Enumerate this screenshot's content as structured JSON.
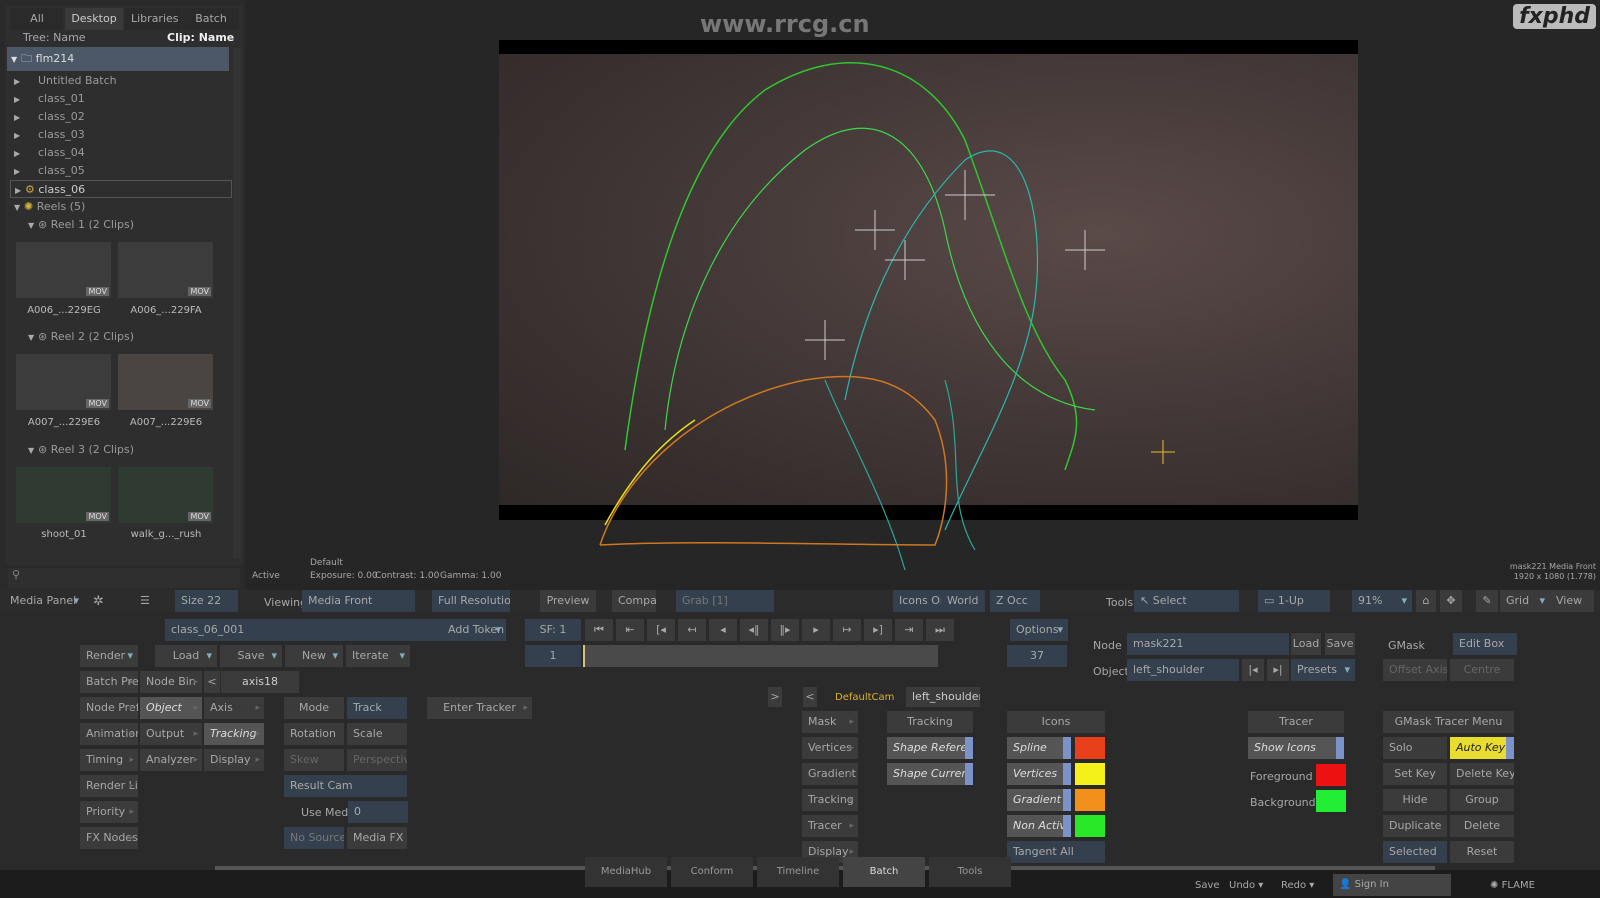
{
  "watermark": "www.rrcg.cn",
  "brand": "fxphd",
  "library": {
    "tabs": [
      "All",
      "Desktop",
      "Libraries",
      "Batch"
    ],
    "tree_label": "Tree: Name",
    "clip_label": "Clip: Name",
    "root": "flm214",
    "items": [
      "Untitled Batch",
      "class_01",
      "class_02",
      "class_03",
      "class_04",
      "class_05",
      "class_06"
    ],
    "reels": "Reels (5)",
    "reel_groups": [
      {
        "name": "Reel 1 (2 Clips)",
        "clips": [
          "A006_...229EG",
          "A006_...229FA"
        ]
      },
      {
        "name": "Reel 2 (2 Clips)",
        "clips": [
          "A007_...229E6",
          "A007_...229E6"
        ]
      },
      {
        "name": "Reel 3 (2 Clips)",
        "clips": [
          "shoot_01",
          "walk_g..._rush"
        ]
      }
    ],
    "badge": "MOV"
  },
  "viewer": {
    "status": "Active",
    "preset": "Default",
    "exposure": "Exposure: 0.00",
    "contrast": "Contrast: 1.00",
    "gamma": "Gamma: 1.00",
    "info1": "mask221 Media Front",
    "info2": "1920 x 1080 (1.778)"
  },
  "toolbar": {
    "media_panel": "Media Panel",
    "size": "Size 22",
    "viewing": "Viewing",
    "media_front": "Media Front",
    "full_res": "Full Resolution",
    "preview": "Preview",
    "compare": "Compare",
    "grab": "Grab [1]",
    "icons_on": "Icons On",
    "world": "World",
    "z_occ": "Z Occ",
    "tools": "Tools",
    "select": "Select",
    "one_up": "1-Up",
    "zoom": "91%",
    "grid": "Grid",
    "view": "View"
  },
  "batch": {
    "name_field": "class_06_001",
    "add_token": "Add Token",
    "render": "Render",
    "load": "Load",
    "save": "Save",
    "new": "New",
    "iterate": "Iterate",
    "batch_prefs": "Batch Prefs",
    "node_bin": "Node Bin",
    "axis_field": "axis18",
    "node_prefs": "Node Prefs",
    "object": "Object",
    "axis": "Axis",
    "animation": "Animation",
    "output": "Output",
    "tracking": "Tracking",
    "timing": "Timing",
    "analyzer": "Analyzer",
    "display": "Display",
    "render_list": "Render List",
    "priority": "Priority",
    "fx_nodes": "FX Nodes"
  },
  "tracker": {
    "mode": "Mode",
    "track": "Track",
    "enter_tracker": "Enter Tracker",
    "rotation": "Rotation",
    "scale": "Scale",
    "skew": "Skew",
    "perspective": "Perspective",
    "result_cam": "Result Cam",
    "use_media": "Use Media",
    "use_media_value": "0",
    "no_source": "No Source",
    "media_fx": "Media FX"
  },
  "timeline": {
    "sf": "SF: 1",
    "start": "1",
    "end": "37",
    "options": "Options",
    "default_cam": "DefaultCam",
    "object_tab": "left_shoulder"
  },
  "gmask": {
    "mask": "Mask",
    "vertices": "Vertices",
    "gradient": "Gradient",
    "tracking": "Tracking",
    "tracer": "Tracer",
    "display": "Display",
    "tracking_header": "Tracking",
    "shape_reference": "Shape Reference",
    "shape_current": "Shape Current",
    "icons_header": "Icons",
    "icons": [
      {
        "label": "Spline",
        "color": "#e8401a"
      },
      {
        "label": "Vertices",
        "color": "#f4f01a"
      },
      {
        "label": "Gradient",
        "color": "#f0901a"
      },
      {
        "label": "Non Active",
        "color": "#28e828"
      }
    ],
    "tangent_all": "Tangent All",
    "tracer_header": "Tracer",
    "show_icons": "Show Icons",
    "foreground": "Foreground",
    "foreground_color": "#ee1111",
    "background": "Background",
    "background_color": "#22ee33",
    "node_label": "Node",
    "node_value": "mask221",
    "load": "Load",
    "save": "Save",
    "object_label": "Object",
    "object_value": "left_shoulder",
    "presets": "Presets",
    "gmask": "GMask",
    "edit_box": "Edit Box",
    "offset_axis": "Offset Axis",
    "centre": "Centre",
    "tracer_menu": "GMask Tracer Menu",
    "solo": "Solo",
    "auto_key": "Auto Key",
    "set_key": "Set Key",
    "delete_key": "Delete Key",
    "hide": "Hide",
    "group": "Group",
    "duplicate": "Duplicate",
    "delete": "Delete",
    "selected": "Selected",
    "reset": "Reset"
  },
  "bottom": {
    "tabs": [
      "MediaHub",
      "Conform",
      "Timeline",
      "Batch",
      "Tools"
    ],
    "active_tab": "Batch",
    "save": "Save",
    "undo": "Undo",
    "redo": "Redo",
    "sign_in": "Sign In",
    "app": "FLAME"
  }
}
